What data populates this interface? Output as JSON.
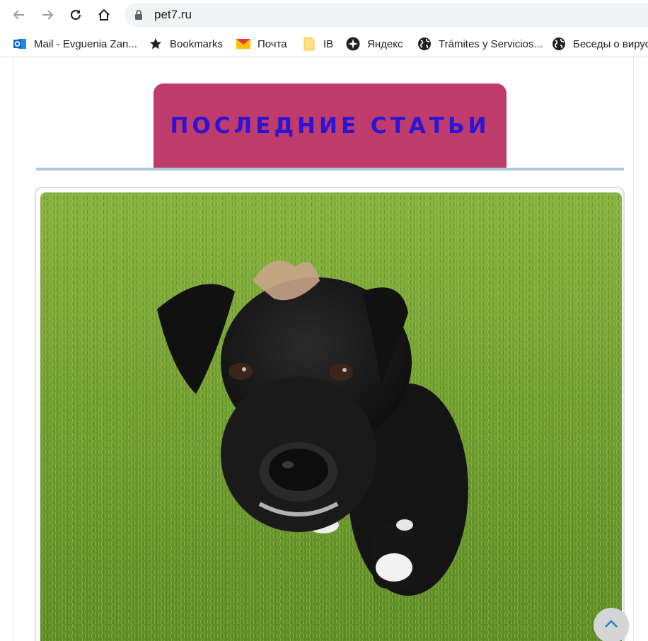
{
  "browser": {
    "url": "pet7.ru",
    "nav_icons": [
      "back-arrow-icon",
      "forward-arrow-icon",
      "reload-icon",
      "home-icon"
    ],
    "bookmarks": [
      {
        "label": "Mail - Evguenia Zan...",
        "icon": "outlook-icon"
      },
      {
        "label": "Bookmarks",
        "icon": "star-icon"
      },
      {
        "label": "Почта",
        "icon": "gmail-icon"
      },
      {
        "label": "IB",
        "icon": "folder-icon"
      },
      {
        "label": "Яндекс",
        "icon": "compass-icon"
      },
      {
        "label": "Trámites y Servicios...",
        "icon": "globe-icon"
      },
      {
        "label": "Беседы о вирус",
        "icon": "globe-icon"
      }
    ]
  },
  "page": {
    "heading": "ПОСЛЕДНИЕ СТАТЬИ",
    "colors": {
      "heading_bg": "#bf3b6b",
      "heading_text": "#2a14d6",
      "rule": "#a9c9d6",
      "grass": "#6c9a31"
    },
    "scroll_top_icon": "chevron-up-icon"
  }
}
